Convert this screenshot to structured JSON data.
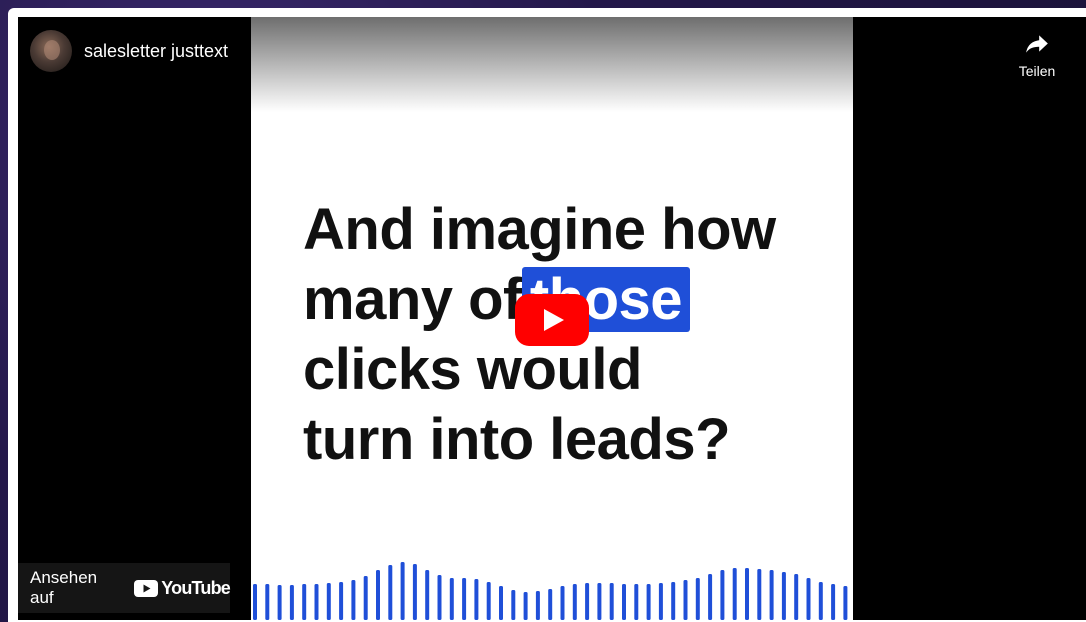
{
  "channel": {
    "name": "salesletter justtext"
  },
  "share": {
    "label": "Teilen"
  },
  "video": {
    "caption_lines": [
      "And imagine how",
      "many of",
      "those",
      "clicks would",
      "turn into leads?"
    ],
    "highlight_color": "#1f4fd8"
  },
  "watch_on": {
    "label": "Ansehen auf",
    "brand": "YouTube"
  },
  "colors": {
    "play_button": "#ff0000",
    "wave": "#1f4fd8"
  }
}
